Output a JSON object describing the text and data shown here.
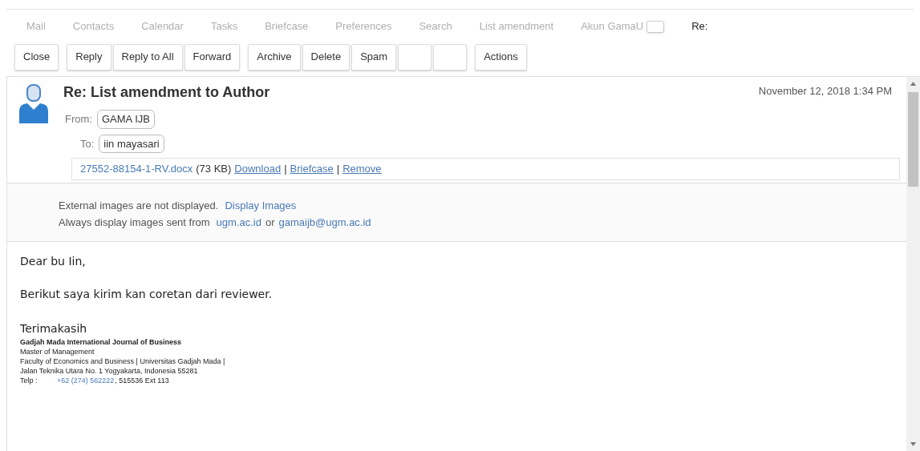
{
  "tabs": [
    {
      "label": "Mail",
      "selected": false
    },
    {
      "label": "Contacts",
      "selected": false
    },
    {
      "label": "Calendar",
      "selected": false
    },
    {
      "label": "Tasks",
      "selected": false
    },
    {
      "label": "Briefcase",
      "selected": false
    },
    {
      "label": "Preferences",
      "selected": false
    },
    {
      "label": "Search",
      "selected": false
    },
    {
      "label": "List amendment",
      "selected": false
    },
    {
      "label": "Akun GamaU",
      "selected": false,
      "closable": true
    },
    {
      "label": "Re:",
      "selected": true
    }
  ],
  "toolbar": [
    [
      {
        "kind": "text",
        "label": "Close"
      }
    ],
    [
      {
        "kind": "text",
        "label": "Reply"
      },
      {
        "kind": "text",
        "label": "Reply to All"
      },
      {
        "kind": "text",
        "label": "Forward"
      }
    ],
    [
      {
        "kind": "text",
        "label": "Archive"
      },
      {
        "kind": "text",
        "label": "Delete"
      },
      {
        "kind": "text",
        "label": "Spam"
      },
      {
        "kind": "blank"
      },
      {
        "kind": "blank"
      }
    ],
    [
      {
        "kind": "text",
        "label": "Actions"
      }
    ]
  ],
  "message": {
    "subject": "Re: List amendment to Author",
    "date": "November 12, 2018 1:34 PM",
    "from_label": "From:",
    "from": "GAMA IJB",
    "to_label": "To:",
    "to": "iin mayasari",
    "attachment": {
      "name": "27552-88154-1-RV.docx",
      "size": "(73 KB)",
      "actions": [
        "Download",
        "Briefcase",
        "Remove"
      ],
      "separator": "|"
    },
    "images_notice": "External images are not displayed.",
    "display_images": "Display Images",
    "always_text": "Always display images sent from",
    "domain": "ugm.ac.id",
    "or": "or",
    "address": "gamaijb@ugm.ac.id"
  },
  "body": {
    "greeting": "Dear bu Iin,",
    "line": "Berikut saya kirim kan coretan dari reviewer.",
    "closing": "Terimakasih",
    "signature": [
      {
        "text": "Gadjah Mada International Journal of Business",
        "bold": true
      },
      {
        "text": "Master of Management",
        "bold": false
      },
      {
        "text": "Faculty of Economics and Business | Universitas Gadjah Mada |",
        "bold": false
      },
      {
        "text": "Jalan Teknika Utara No. 1 Yogyakarta, Indonesia 55281",
        "bold": false
      }
    ],
    "phone_label": "Telp :",
    "phone_link": "+62 (274) 562222",
    "phone_rest": ", 515536 Ext 113"
  }
}
